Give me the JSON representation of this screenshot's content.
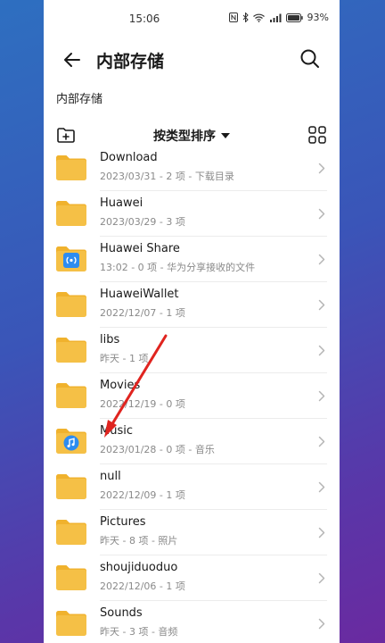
{
  "status": {
    "time": "15:06",
    "battery": "93%"
  },
  "header": {
    "title": "内部存储"
  },
  "breadcrumb": "内部存储",
  "toolbar": {
    "sort_label": "按类型排序"
  },
  "colors": {
    "folder": "#f5c046",
    "folder_tab": "#f0b22d",
    "badge": "#2d8cf0",
    "arrow": "#e0241f"
  },
  "folders": [
    {
      "name": "Download",
      "meta": "2023/03/31 - 2 项 - 下载目录",
      "badge": ""
    },
    {
      "name": "Huawei",
      "meta": "2023/03/29 - 3 项",
      "badge": ""
    },
    {
      "name": "Huawei Share",
      "meta": "13:02 - 0 项 - 华为分享接收的文件",
      "badge": "share-icon"
    },
    {
      "name": "HuaweiWallet",
      "meta": "2022/12/07 - 1 项",
      "badge": ""
    },
    {
      "name": "libs",
      "meta": "昨天 - 1 项",
      "badge": ""
    },
    {
      "name": "Movies",
      "meta": "2022/12/19 - 0 项",
      "badge": ""
    },
    {
      "name": "Music",
      "meta": "2023/01/28 - 0 项 - 音乐",
      "badge": "music-icon"
    },
    {
      "name": "null",
      "meta": "2022/12/09 - 1 项",
      "badge": ""
    },
    {
      "name": "Pictures",
      "meta": "昨天 - 8 项 - 照片",
      "badge": ""
    },
    {
      "name": "shoujiduoduo",
      "meta": "2022/12/06 - 1 项",
      "badge": ""
    },
    {
      "name": "Sounds",
      "meta": "昨天 - 3 项 - 音频",
      "badge": ""
    }
  ]
}
